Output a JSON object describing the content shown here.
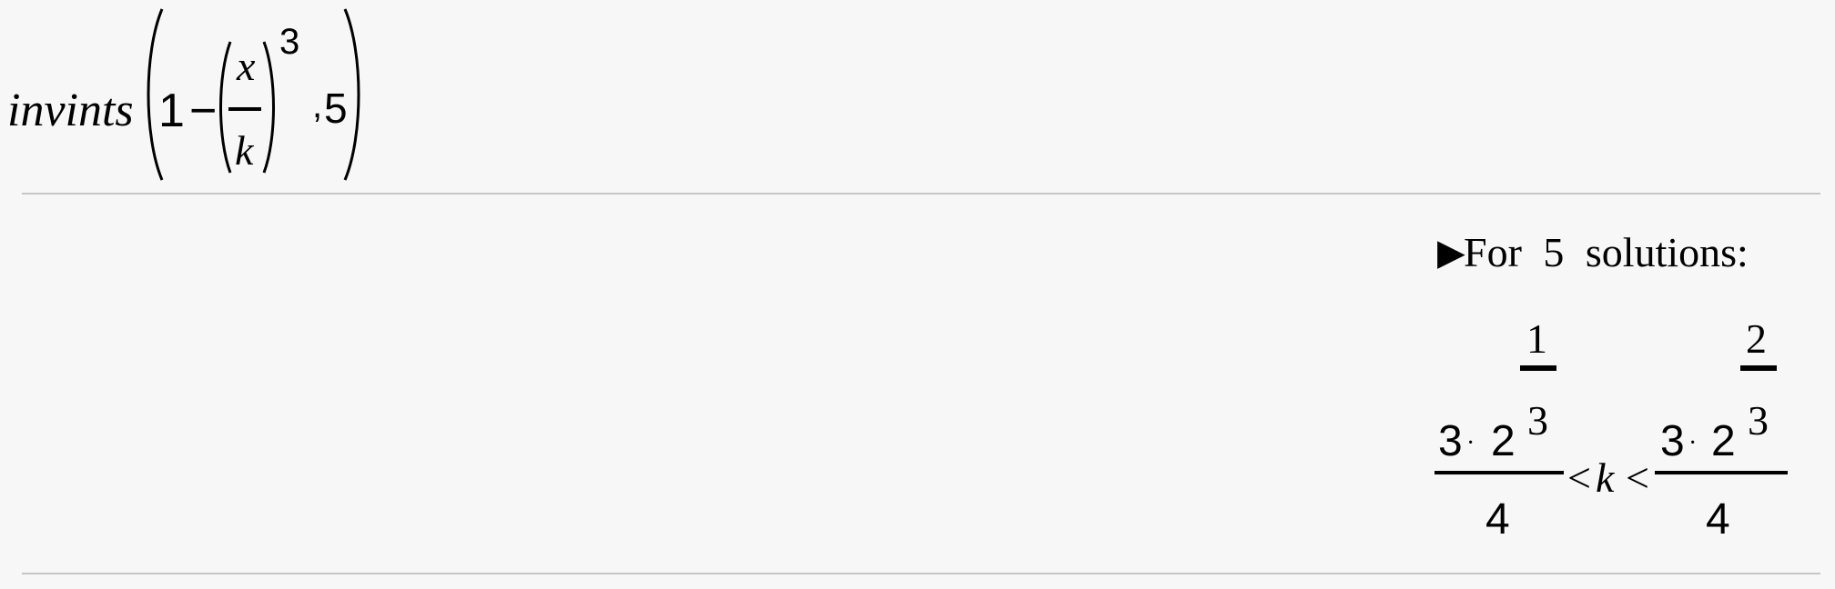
{
  "input": {
    "function_name": "invints",
    "one": "1",
    "minus": "−",
    "fraction_numerator": "x",
    "fraction_denominator": "k",
    "exponent": "3",
    "comma": ",",
    "count": "5"
  },
  "output": {
    "disclosure_icon": "right-triangle-icon",
    "heading": "For 5 solutions:",
    "left_bound": {
      "coefficient": "3",
      "dot": "·",
      "base": "2",
      "exponent_numerator": "1",
      "exponent_denominator": "3",
      "denominator": "4"
    },
    "lt_1": "<",
    "variable": "k",
    "lt_2": "<",
    "right_bound": {
      "coefficient": "3",
      "dot": "·",
      "base": "2",
      "exponent_numerator": "2",
      "exponent_denominator": "3",
      "denominator": "4"
    }
  }
}
